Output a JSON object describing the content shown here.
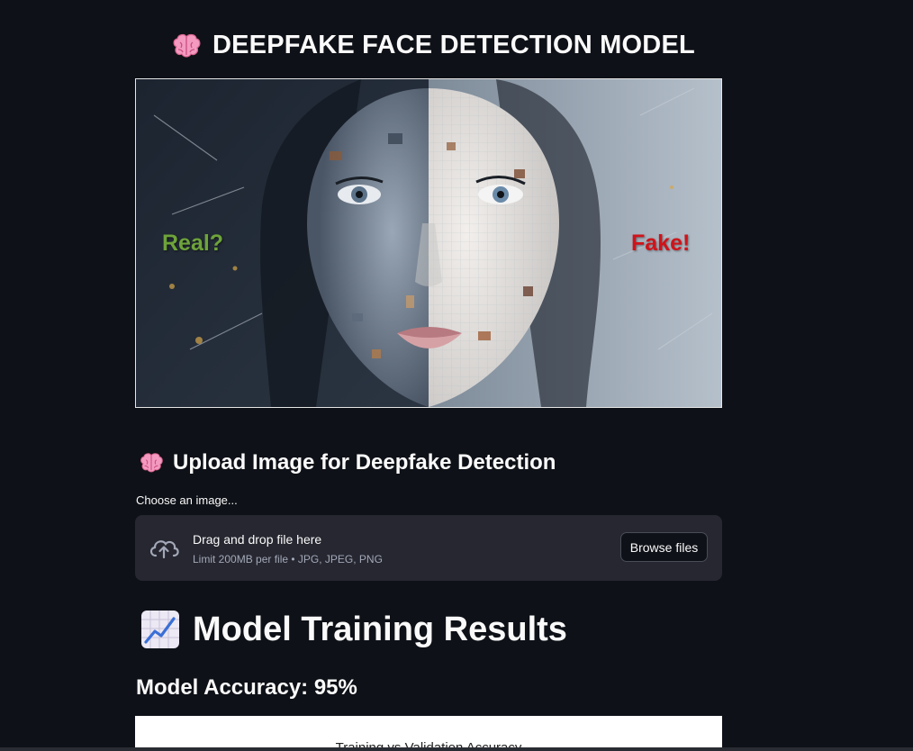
{
  "header": {
    "title": "DEEPFAKE FACE DETECTION MODEL"
  },
  "hero": {
    "real_label": "Real?",
    "fake_label": "Fake!"
  },
  "upload": {
    "heading": "Upload Image for Deepfake Detection",
    "field_label": "Choose an image...",
    "drop_text": "Drag and drop file here",
    "limit_text": "Limit 200MB per file • JPG, JPEG, PNG",
    "browse_label": "Browse files"
  },
  "results": {
    "heading": "Model Training Results",
    "accuracy_text": "Model Accuracy: 95%",
    "chart_title": "Training vs Validation Accuracy"
  },
  "colors": {
    "background": "#0e1117",
    "dropzone": "#262730",
    "real_label": "#6ea33a",
    "fake_label": "#d0131a"
  },
  "icons": {
    "title": "brain-icon",
    "upload_heading": "brain-icon",
    "dropzone": "cloud-upload-icon",
    "results_heading": "chart-increasing-icon"
  }
}
